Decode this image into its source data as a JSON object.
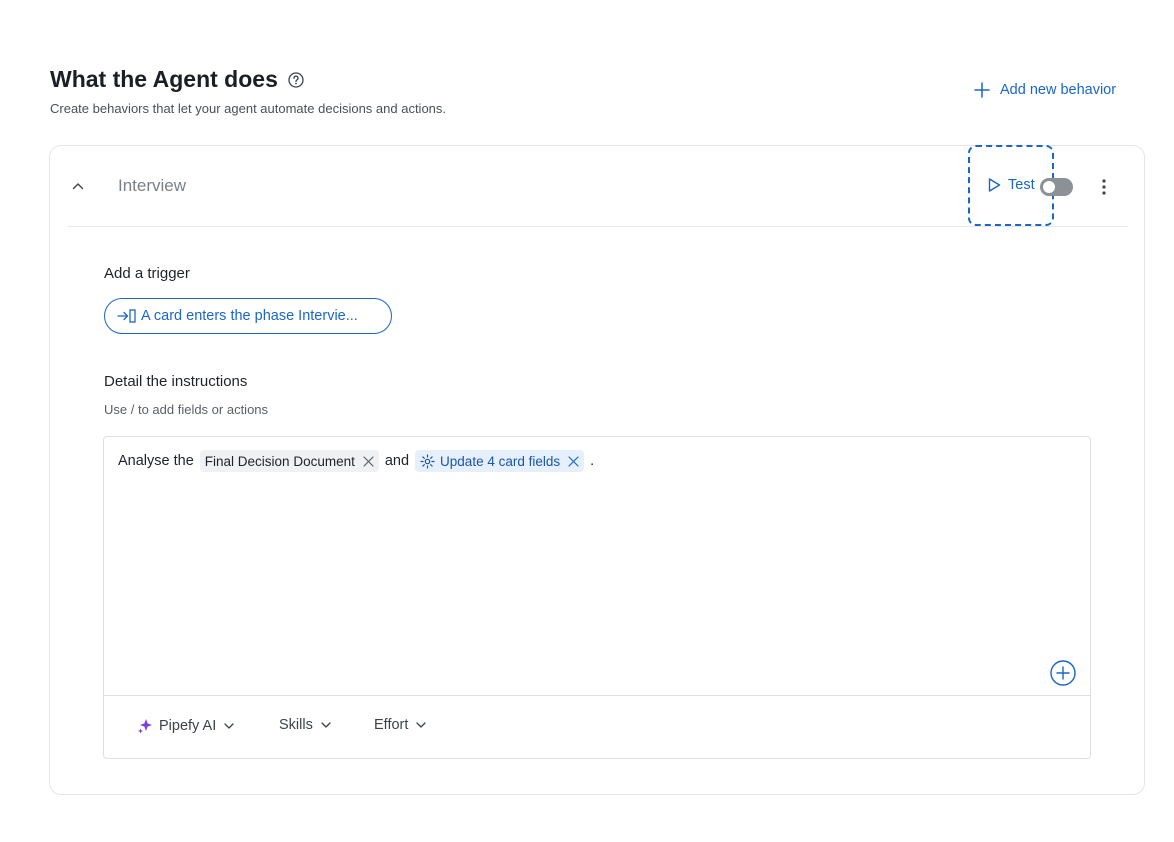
{
  "header": {
    "title": "What the Agent does",
    "subtitle": "Create behaviors that let your agent automate decisions and actions.",
    "add_behavior_label": "Add new behavior"
  },
  "behavior": {
    "name": "Interview",
    "test_label": "Test",
    "enabled": false,
    "trigger": {
      "section_label": "Add a trigger",
      "pill_label": "A card enters the phase Intervie..."
    },
    "instructions": {
      "section_label": "Detail the instructions",
      "hint": "Use / to add fields or actions",
      "text_before": "Analyse the",
      "field_chip": "Final Decision Document",
      "text_middle": "and",
      "action_chip": "Update 4 card fields",
      "text_after": "."
    },
    "footer": {
      "model_label": "Pipefy AI",
      "skills_label": "Skills",
      "effort_label": "Effort"
    }
  },
  "colors": {
    "accent": "#1a66c9",
    "toggle_off": "#8c9197",
    "sparkle": "#7b3fe4"
  },
  "icons": [
    "help-circle-icon",
    "plus-icon",
    "chevron-up-icon",
    "play-icon",
    "more-vertical-icon",
    "enter-phase-icon",
    "close-icon",
    "gear-icon",
    "plus-circle-icon",
    "sparkle-icon",
    "chevron-down-icon"
  ]
}
